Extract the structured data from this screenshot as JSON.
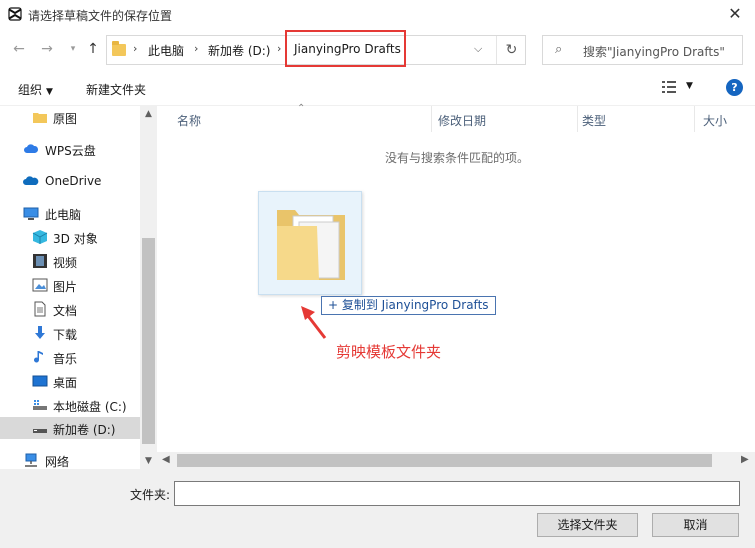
{
  "window": {
    "title": "请选择草稿文件的保存位置"
  },
  "nav": {
    "breadcrumbs": [
      "此电脑",
      "新加卷 (D:)",
      "JianyingPro Drafts"
    ],
    "search_placeholder": "搜索\"JianyingPro Drafts\""
  },
  "toolbar": {
    "organize_label": "组织",
    "new_folder_label": "新建文件夹"
  },
  "sidebar": {
    "items": [
      {
        "label": "原图",
        "icon": "folder-icon"
      },
      {
        "label": "WPS云盘",
        "icon": "cloud-icon"
      },
      {
        "label": "OneDrive",
        "icon": "cloud-icon"
      },
      {
        "label": "此电脑",
        "icon": "computer-icon"
      },
      {
        "label": "3D 对象",
        "icon": "cube-icon"
      },
      {
        "label": "视频",
        "icon": "film-icon"
      },
      {
        "label": "图片",
        "icon": "picture-icon"
      },
      {
        "label": "文档",
        "icon": "document-icon"
      },
      {
        "label": "下载",
        "icon": "download-icon"
      },
      {
        "label": "音乐",
        "icon": "music-icon"
      },
      {
        "label": "桌面",
        "icon": "desktop-icon"
      },
      {
        "label": "本地磁盘 (C:)",
        "icon": "drive-icon"
      },
      {
        "label": "新加卷 (D:)",
        "icon": "drive-icon",
        "selected": true
      },
      {
        "label": "网络",
        "icon": "network-icon"
      }
    ]
  },
  "list": {
    "columns": [
      "名称",
      "修改日期",
      "类型",
      "大小"
    ],
    "empty_message": "没有与搜索条件匹配的项。"
  },
  "drag": {
    "label": "+ 复制到 JianyingPro Drafts"
  },
  "annotation": {
    "text": "剪映模板文件夹",
    "color": "#e53935"
  },
  "footer": {
    "filename_label": "文件夹:",
    "filename_value": "",
    "select_button": "选择文件夹",
    "cancel_button": "取消"
  },
  "colors": {
    "accent": "#1565c0",
    "highlight": "#e53935",
    "folder": "#f3c75a"
  }
}
